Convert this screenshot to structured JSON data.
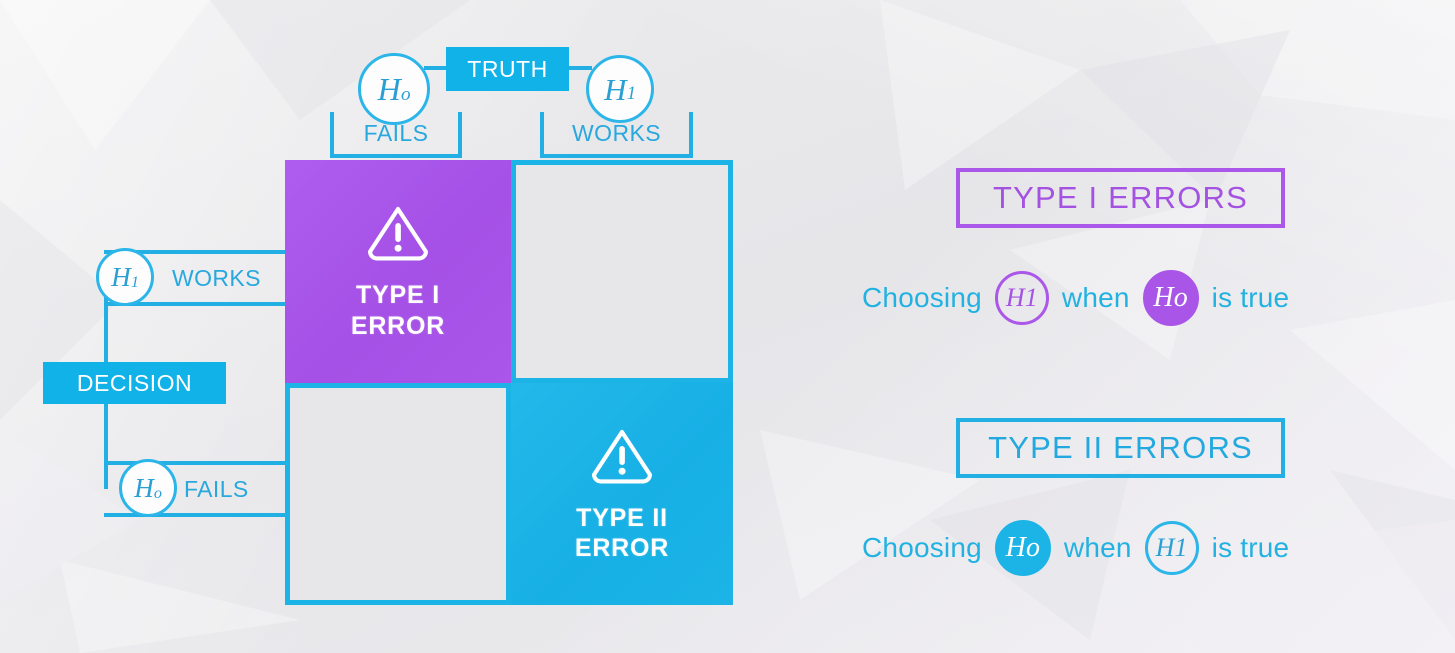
{
  "theme": {
    "cyan": "#1cb4e6",
    "cyan_line": "#22b0e4",
    "cyan_text": "#23a9df",
    "purple": "#a855e8",
    "purple_line": "#ab57ea",
    "purple_text": "#a352e2",
    "background": "#e9e9eb",
    "cell_empty_bg": "#e7e7e9",
    "white": "#ffffff"
  },
  "matrix": {
    "truth_header": {
      "label": "TRUTH",
      "columns": [
        {
          "token": "H",
          "subscript": "o",
          "label": "FAILS"
        },
        {
          "token": "H",
          "subscript": "1",
          "label": "WORKS"
        }
      ]
    },
    "decision_header": {
      "label": "DECISION",
      "rows": [
        {
          "token": "H",
          "subscript": "1",
          "label": "WORKS"
        },
        {
          "token": "H",
          "subscript": "o",
          "label": "FAILS"
        }
      ]
    },
    "cells": [
      {
        "id": "type-i",
        "line1": "TYPE I",
        "line2": "ERROR",
        "icon": "warning-triangle-icon",
        "state": "error-type-1"
      },
      {
        "id": "top-right",
        "line1": "",
        "line2": "",
        "icon": "",
        "state": "empty"
      },
      {
        "id": "bottom-left",
        "line1": "",
        "line2": "",
        "icon": "",
        "state": "empty"
      },
      {
        "id": "type-ii",
        "line1": "TYPE II",
        "line2": "ERROR",
        "icon": "warning-triangle-icon",
        "state": "error-type-2"
      }
    ]
  },
  "legend": {
    "type_i": {
      "title": "TYPE I ERRORS",
      "sentence": {
        "lead": "Choosing",
        "chosen": {
          "token": "H",
          "subscript": "1"
        },
        "middle": "when",
        "truth": {
          "token": "H",
          "subscript": "o"
        },
        "tail": "is true"
      }
    },
    "type_ii": {
      "title": "TYPE II ERRORS",
      "sentence": {
        "lead": "Choosing",
        "chosen": {
          "token": "H",
          "subscript": "o"
        },
        "middle": "when",
        "truth": {
          "token": "H",
          "subscript": "1"
        },
        "tail": "is true"
      }
    }
  }
}
